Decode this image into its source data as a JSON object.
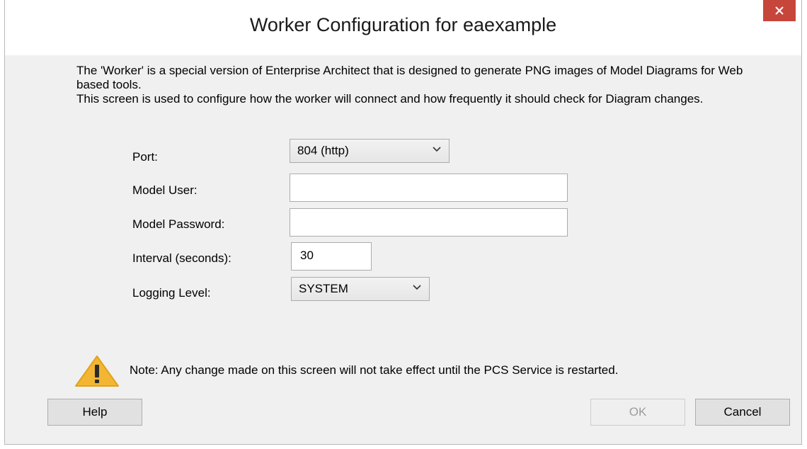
{
  "dialog": {
    "title": "Worker Configuration for eaexample",
    "close_icon": "close-icon",
    "accent_close_color": "#c7463c"
  },
  "description": {
    "line1": "The 'Worker' is a special version of Enterprise Architect that is designed to generate PNG images of Model Diagrams for Web based tools.",
    "line2": "This screen is used to configure how the worker will connect and how frequently it should check for Diagram changes."
  },
  "form": {
    "port_label": "Port:",
    "port_value": "804 (http)",
    "model_user_label": "Model User:",
    "model_user_value": "",
    "model_password_label": "Model Password:",
    "model_password_value": "",
    "interval_label": "Interval (seconds):",
    "interval_value": "30",
    "logging_level_label": "Logging Level:",
    "logging_level_value": "SYSTEM"
  },
  "note": {
    "icon": "warning-icon",
    "text": "Note: Any change made on this screen will not take effect until the PCS Service is restarted."
  },
  "buttons": {
    "help": "Help",
    "ok": "OK",
    "cancel": "Cancel"
  }
}
